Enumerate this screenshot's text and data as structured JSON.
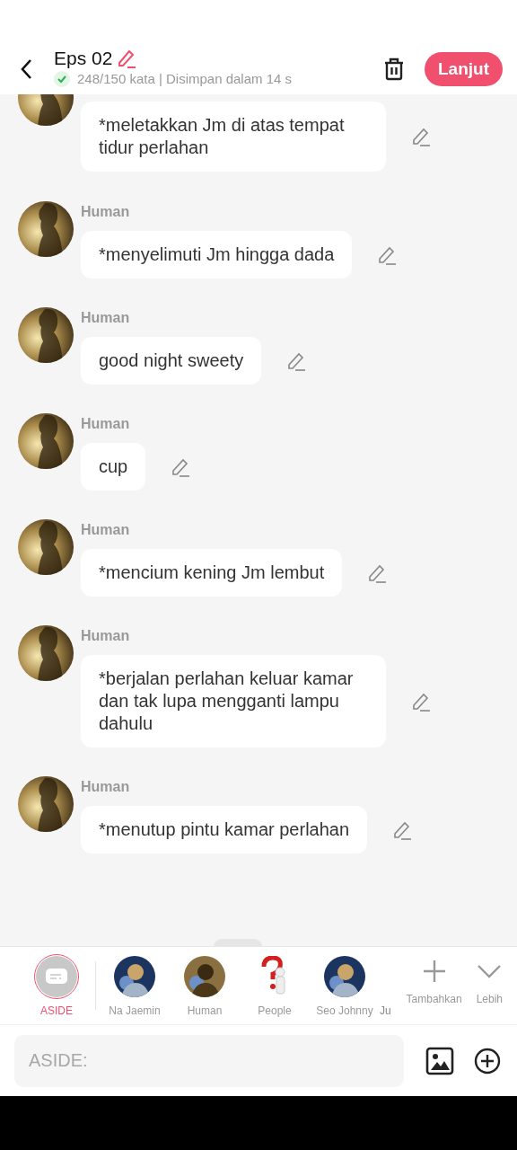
{
  "header": {
    "title": "Eps 02",
    "status": "248/150 kata | Disimpan dalam 14 s",
    "action": "Lanjut"
  },
  "messages": [
    {
      "text": "*meletakkan Jm di atas tempat tidur perlahan"
    },
    {
      "name": "Human",
      "text": "*menyelimuti Jm hingga dada"
    },
    {
      "name": "Human",
      "text": "good night sweety"
    },
    {
      "name": "Human",
      "text": "cup"
    },
    {
      "name": "Human",
      "text": "*mencium kening Jm lembut"
    },
    {
      "name": "Human",
      "text": "*berjalan perlahan keluar kamar dan tak lupa mengganti lampu dahulu"
    },
    {
      "name": "Human",
      "text": "*menutup pintu kamar perlahan"
    }
  ],
  "characters": [
    {
      "name": "ASIDE",
      "kind": "aside",
      "selected": true
    },
    {
      "name": "Na Jaemin",
      "kind": "picture",
      "selected": false
    },
    {
      "name": "Human",
      "kind": "picture",
      "selected": false
    },
    {
      "name": "People",
      "kind": "question",
      "selected": false
    },
    {
      "name": "Seo Johnny",
      "kind": "picture",
      "selected": false
    },
    {
      "name": "Ju",
      "kind": "cut",
      "selected": false
    }
  ],
  "actions": [
    {
      "label": "Tambahkan",
      "kind": "add"
    },
    {
      "label": "Lebih",
      "kind": "more"
    }
  ],
  "input": {
    "placeholder": "ASIDE:"
  }
}
